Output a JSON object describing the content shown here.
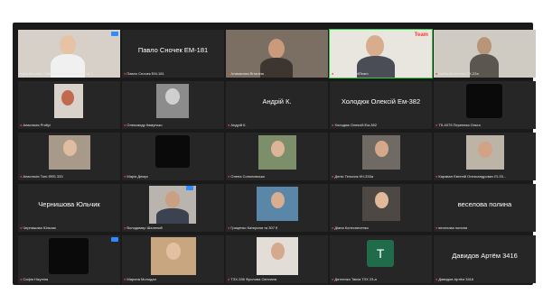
{
  "colors": {
    "background": "#1a1a1a",
    "tile": "#262626",
    "active_speaker": "#2ecc40",
    "muted_mic": "#ff3b30",
    "badge": "#2d8cff"
  },
  "icons": {
    "muted": "muted-mic-icon",
    "badge": "raised-hand-icon"
  },
  "stream_logo": "Team",
  "participants": [
    {
      "name": "Iryna Blonska, Odesa National University of T...",
      "display": ""
    },
    {
      "name": "Павло Сночек ЕМ-181",
      "display": "Павло Сночек ЕМ-181"
    },
    {
      "name": "Атамасова Віталіна",
      "display": ""
    },
    {
      "name": "ProfiTeam ProfiTeam",
      "display": ""
    },
    {
      "name": "Бабак Валентин ТХ-22а",
      "display": ""
    },
    {
      "name": "Анастасія Profiyi",
      "display": ""
    },
    {
      "name": "Олександр Камунько",
      "display": ""
    },
    {
      "name": "Андрій К.",
      "display": "Андрій К."
    },
    {
      "name": "Холодюк Олексій Ем-382",
      "display": "Холодюк Олексій Ем-382"
    },
    {
      "name": "ТК-4075 Перепека Ольга",
      "display": ""
    },
    {
      "name": "Анастасія Тоні-ФЕБ 333",
      "display": ""
    },
    {
      "name": "Марія Демус",
      "display": ""
    },
    {
      "name": "Олена Сопоновська",
      "display": ""
    },
    {
      "name": "Деніс Тельник КН-333а",
      "display": ""
    },
    {
      "name": "Караван Євгеній Олександрович ЕІ-33...",
      "display": ""
    },
    {
      "name": "Чернишова Юльчик",
      "display": "Чернишова Юльчик"
    },
    {
      "name": "Володимир Шалений",
      "display": ""
    },
    {
      "name": "Гриценко Катерина та 307 б",
      "display": ""
    },
    {
      "name": "Діана Колесниченко",
      "display": ""
    },
    {
      "name": "веселова полина",
      "display": "веселова полина"
    },
    {
      "name": "Софія Нікуліна",
      "display": ""
    },
    {
      "name": "Марина Молодан",
      "display": ""
    },
    {
      "name": "ТЗХ-336 Фролова Світлана",
      "display": ""
    },
    {
      "name": "Дятленко Taicia ТЗХ 23-а",
      "display": ""
    },
    {
      "name": "Давидов Артём 3416",
      "display": "Давидов Артём 3416"
    }
  ],
  "avatar_letter": "T"
}
